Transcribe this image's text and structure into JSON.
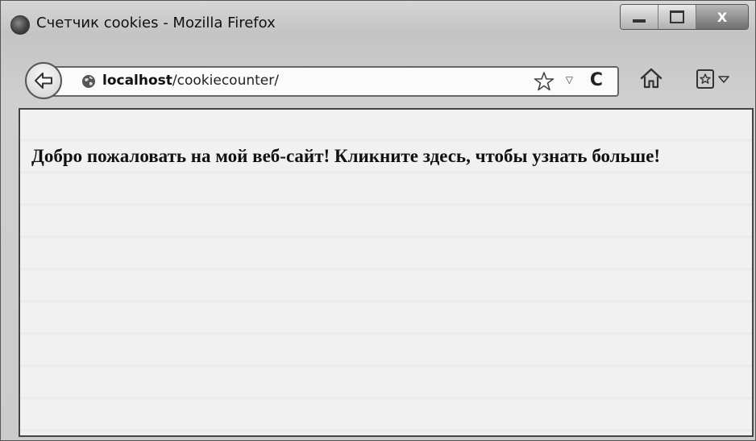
{
  "window": {
    "title": "Счетчик cookies - Mozilla Firefox",
    "controls": {
      "minimize": "minimize",
      "maximize": "maximize",
      "close": "X"
    }
  },
  "navbar": {
    "url_host": "localhost",
    "url_path": "/cookiecounter/",
    "reload_glyph": "C",
    "dropdown_glyph": "▽"
  },
  "page": {
    "welcome_text": "Добро пожаловать на мой веб-сайт! Кликните здесь, чтобы узнать больше!"
  },
  "icons": {
    "app": "firefox-icon",
    "back": "back-arrow-icon",
    "site": "globe-icon",
    "bookmark": "star-icon",
    "reload": "reload-icon",
    "home": "home-icon",
    "bookmarks_menu": "bookmarks-icon"
  }
}
